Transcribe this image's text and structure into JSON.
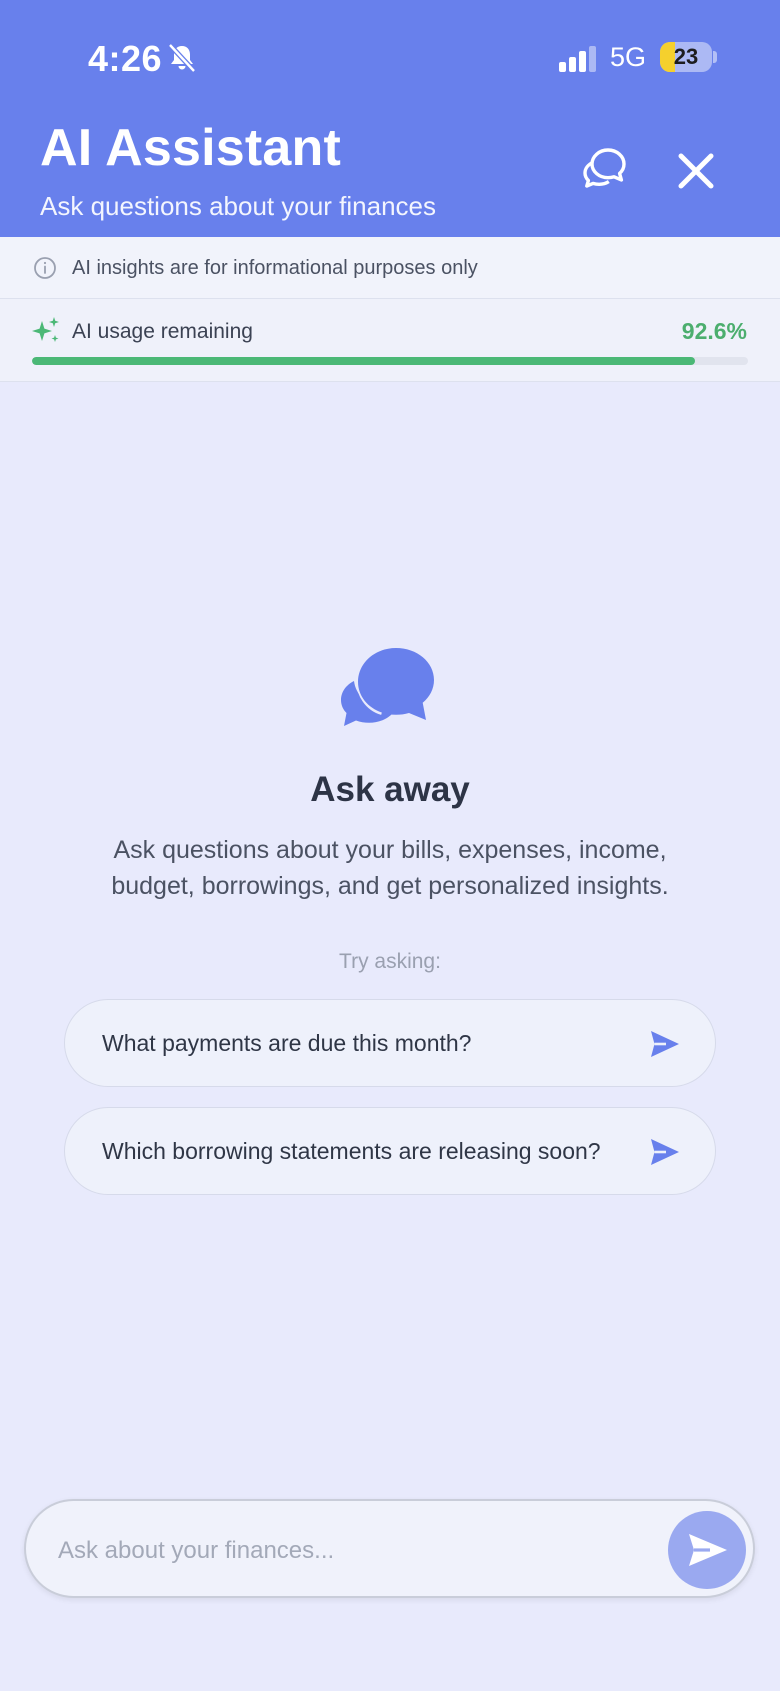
{
  "status_bar": {
    "time": "4:26",
    "network": "5G",
    "battery": "23",
    "icons": [
      "bell-off-icon",
      "signal-icon",
      "battery-icon"
    ]
  },
  "header": {
    "title": "AI Assistant",
    "subtitle": "Ask questions about your finances",
    "icons": [
      "chat-bubble-icon",
      "close-icon"
    ],
    "background_color": "#6880ec"
  },
  "disclaimer": {
    "text": "AI insights are for informational purposes only",
    "icon": "info-icon"
  },
  "usage": {
    "label": "AI usage remaining",
    "value_text": "92.6%",
    "value_fraction": 0.926,
    "icon": "sparkle-icon",
    "accent_color": "#4bb876"
  },
  "empty_state": {
    "icon": "chat-bubbles-icon",
    "title": "Ask away",
    "description": "Ask questions about your bills, expenses, income, budget, borrowings, and get personalized insights.",
    "try_label": "Try asking:",
    "suggestions": [
      {
        "label": "What payments are due this month?",
        "icon": "send-icon"
      },
      {
        "label": "Which borrowing statements are releasing soon?",
        "icon": "send-icon"
      }
    ]
  },
  "composer": {
    "placeholder": "Ask about your finances...",
    "value": "",
    "send_icon": "send-icon",
    "send_color": "#9aa9f0"
  }
}
